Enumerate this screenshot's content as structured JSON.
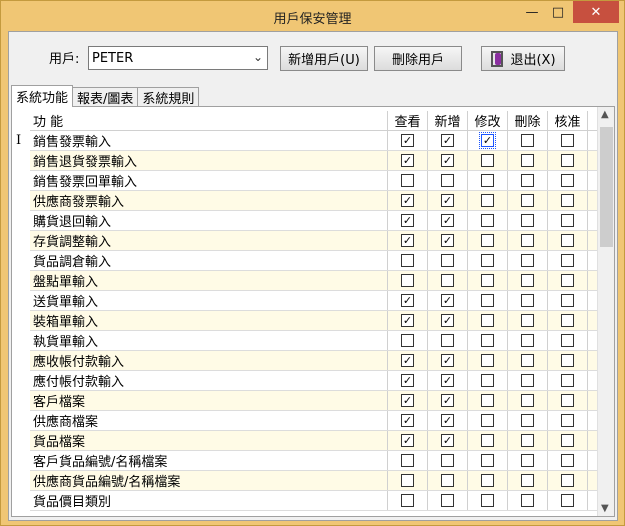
{
  "window": {
    "title": "用戶保安管理",
    "minimize_glyph": "—",
    "maximize_glyph": "□",
    "close_glyph": "✕"
  },
  "toolbar": {
    "user_label": "用戶:",
    "user_value": "PETER",
    "dropdown_glyph": "⌄",
    "add_user_label": "新增用戶(U)",
    "delete_user_label": "刪除用戶",
    "exit_label": "退出(X)"
  },
  "tabs": [
    {
      "label": "系統功能",
      "active": true
    },
    {
      "label": "報表/圖表",
      "active": false
    },
    {
      "label": "系統規則",
      "active": false
    }
  ],
  "grid": {
    "row_indicator": "I",
    "columns": [
      "功 能",
      "查看",
      "新增",
      "修改",
      "刪除",
      "核准"
    ],
    "check_glyph": "✓",
    "rows": [
      {
        "name": "銷售發票輸入",
        "checks": [
          true,
          true,
          true,
          false,
          false
        ]
      },
      {
        "name": "銷售退貨發票輸入",
        "checks": [
          true,
          true,
          false,
          false,
          false
        ]
      },
      {
        "name": "銷售發票回單輸入",
        "checks": [
          false,
          false,
          false,
          false,
          false
        ]
      },
      {
        "name": "供應商發票輸入",
        "checks": [
          true,
          true,
          false,
          false,
          false
        ]
      },
      {
        "name": "購貨退回輸入",
        "checks": [
          true,
          true,
          false,
          false,
          false
        ]
      },
      {
        "name": "存貨調整輸入",
        "checks": [
          true,
          true,
          false,
          false,
          false
        ]
      },
      {
        "name": "貨品調倉輸入",
        "checks": [
          false,
          false,
          false,
          false,
          false
        ]
      },
      {
        "name": "盤點單輸入",
        "checks": [
          false,
          false,
          false,
          false,
          false
        ]
      },
      {
        "name": "送貨單輸入",
        "checks": [
          true,
          true,
          false,
          false,
          false
        ]
      },
      {
        "name": "裝箱單輸入",
        "checks": [
          true,
          true,
          false,
          false,
          false
        ]
      },
      {
        "name": "執貨單輸入",
        "checks": [
          false,
          false,
          false,
          false,
          false
        ]
      },
      {
        "name": "應收帳付款輸入",
        "checks": [
          true,
          true,
          false,
          false,
          false
        ]
      },
      {
        "name": "應付帳付款輸入",
        "checks": [
          true,
          true,
          false,
          false,
          false
        ]
      },
      {
        "name": "客戶檔案",
        "checks": [
          true,
          true,
          false,
          false,
          false
        ]
      },
      {
        "name": "供應商檔案",
        "checks": [
          true,
          true,
          false,
          false,
          false
        ]
      },
      {
        "name": "貨品檔案",
        "checks": [
          true,
          true,
          false,
          false,
          false
        ]
      },
      {
        "name": "客戶貨品編號/名稱檔案",
        "checks": [
          false,
          false,
          false,
          false,
          false
        ]
      },
      {
        "name": "供應商貨品編號/名稱檔案",
        "checks": [
          false,
          false,
          false,
          false,
          false
        ]
      },
      {
        "name": "貨品價目類別",
        "checks": [
          false,
          false,
          false,
          false,
          false
        ]
      }
    ]
  },
  "scrollbar": {
    "up_glyph": "▲",
    "down_glyph": "▼"
  }
}
